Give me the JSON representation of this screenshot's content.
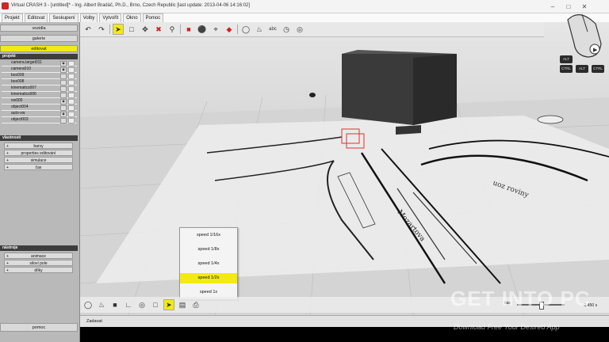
{
  "window": {
    "title": "Virtual CRASH 3 - [untitled]* - Ing. Albert Bradáč, Ph.D., Brno, Czech Republic [last update: 2013-04-06 14:16:02]"
  },
  "menu": [
    "Projekt",
    "Editovat",
    "Seskupení",
    "Volby",
    "Vytvořit",
    "Okno",
    "Pomoc"
  ],
  "sidebar": {
    "mode_buttons": [
      "vozidla",
      "galerie",
      "editovat"
    ],
    "active_mode": "editovat",
    "project_header": "projekt",
    "objects": [
      "camera.target011",
      "camera010",
      "box009",
      "box008",
      "kinematics007",
      "kinematics006",
      "vw005",
      "object004",
      "auto-vw",
      "object003"
    ],
    "properties_header": "vlastnosti",
    "properties": [
      "barvy",
      "properties editování",
      "simulace",
      "čas"
    ],
    "tools_header": "nástroje",
    "tools": [
      "animace",
      "siloví pole",
      "dílky"
    ],
    "bottom_button": "pomoc"
  },
  "toolbar": {
    "icons": [
      "undo-icon",
      "redo-icon",
      "select-icon",
      "rect-select-icon",
      "move-icon",
      "delete-icon",
      "zoom-icon",
      "car-icon",
      "paint-icon",
      "measure-icon",
      "tag-icon",
      "text-icon",
      "clock-icon"
    ]
  },
  "speed_menu": {
    "items": [
      "speed 1/16x",
      "speed 1/8x",
      "speed 1/4x",
      "speed 1/2x",
      "speed 1x"
    ],
    "active": "speed 1/2x"
  },
  "status": {
    "label": "Zadavat"
  },
  "timeline": {
    "time_label": "čas",
    "value": "-2.450 s"
  },
  "navkeys": [
    "ALT",
    "CTRL",
    "ALT",
    "CTRL"
  ],
  "watermark": {
    "brand": "GET INTO PC",
    "tagline": "Download Free Your Desired App"
  }
}
